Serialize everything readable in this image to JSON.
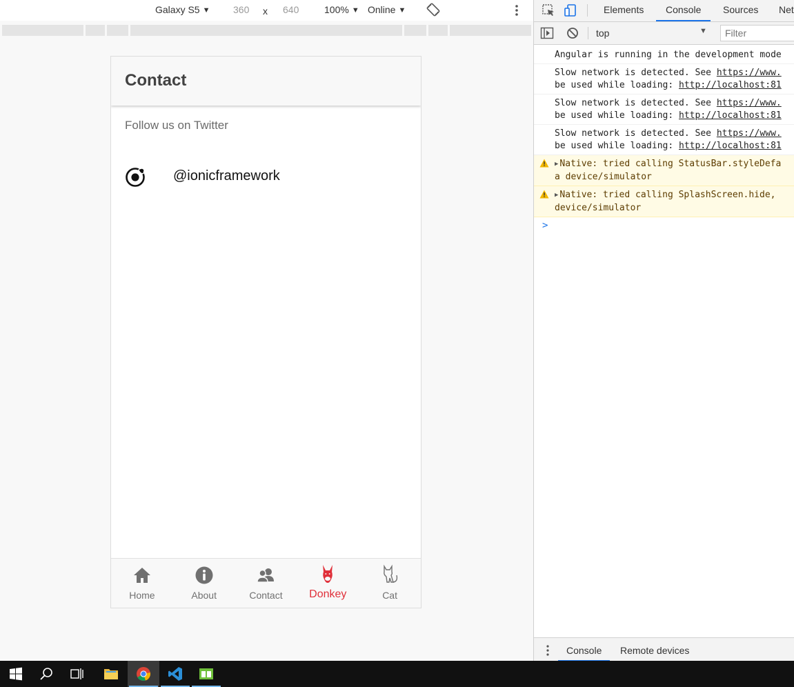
{
  "device_toolbar": {
    "device": "Galaxy S5",
    "width": "360",
    "times": "x",
    "height": "640",
    "zoom": "100%",
    "network": "Online"
  },
  "app": {
    "title": "Contact",
    "follow_text": "Follow us on Twitter",
    "twitter_handle": "@ionicframework",
    "tabs": [
      {
        "label": "Home",
        "icon": "home-icon"
      },
      {
        "label": "About",
        "icon": "info-icon"
      },
      {
        "label": "Contact",
        "icon": "contacts-icon"
      },
      {
        "label": "Donkey",
        "icon": "donkey-icon",
        "active": true
      },
      {
        "label": "Cat",
        "icon": "cat-icon"
      }
    ],
    "accent_color": "#e0303a"
  },
  "devtools": {
    "tabs": [
      "Elements",
      "Console",
      "Sources",
      "Net"
    ],
    "active_tab": "Console",
    "context": "top",
    "filter_placeholder": "Filter",
    "logs": [
      {
        "type": "info",
        "lines": [
          "Angular is running in the development mode"
        ]
      },
      {
        "type": "info",
        "line1_text": "Slow network is detected. See ",
        "line1_link": "https://www.",
        "line2_text": "be used while loading: ",
        "line2_link": "http://localhost:81"
      },
      {
        "type": "info",
        "line1_text": "Slow network is detected. See ",
        "line1_link": "https://www.",
        "line2_text": "be used while loading: ",
        "line2_link": "http://localhost:81"
      },
      {
        "type": "info",
        "line1_text": "Slow network is detected. See ",
        "line1_link": "https://www.",
        "line2_text": "be used while loading: ",
        "line2_link": "http://localhost:81"
      },
      {
        "type": "warn",
        "line1": "Native: tried calling StatusBar.styleDefa",
        "line2": "a device/simulator"
      },
      {
        "type": "warn",
        "line1": "Native: tried calling SplashScreen.hide,",
        "line2": "device/simulator"
      }
    ],
    "prompt": ">",
    "drawer_tabs": [
      "Console",
      "Remote devices"
    ]
  }
}
